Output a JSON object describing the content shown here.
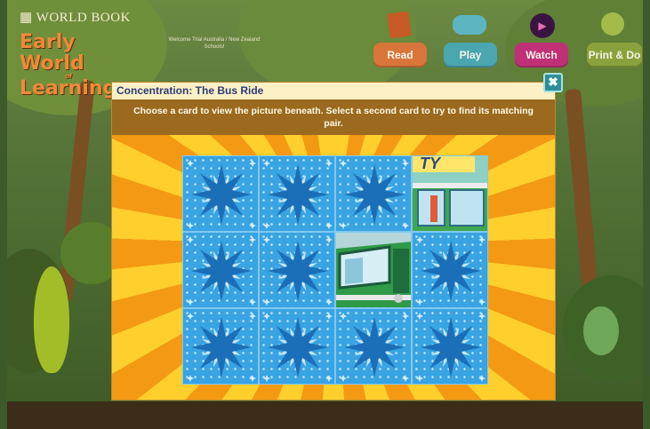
{
  "header": {
    "brand_small": "WORLD BOOK",
    "brand_line1": "Early World",
    "brand_line2": "of",
    "brand_line3": "Learning",
    "welcome": "Welcome Trial Australia / New Zealand Schools!"
  },
  "nav": [
    {
      "label": "Read",
      "icon": "book-icon"
    },
    {
      "label": "Play",
      "icon": "gamepad-icon"
    },
    {
      "label": "Watch",
      "icon": "play-icon"
    },
    {
      "label": "Print & Do",
      "icon": "pencil-icon"
    }
  ],
  "modal": {
    "title": "Concentration: The Bus Ride",
    "close_glyph": "✖",
    "instructions": "Choose a card to view the picture beneath. Select a second card to try to find its matching pair."
  },
  "game": {
    "rows": 3,
    "cols": 4,
    "revealed_cards": [
      3,
      6
    ],
    "revealed_text": "TY",
    "card_icon": "star-icon",
    "colors": {
      "card_blue": "#39a3e3",
      "star_dark": "#1b6fb8",
      "star_light": "#d3eefc"
    }
  }
}
